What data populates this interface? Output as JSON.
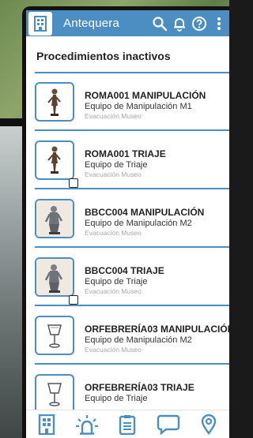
{
  "header": {
    "title": "Antequera"
  },
  "section": {
    "title": "Procedimientos inactivos"
  },
  "procedures": [
    {
      "title": "ROMA001 MANIPULACIÓN",
      "team": "Equipo de Manipulación M1",
      "type": "Evacuación Museo",
      "checkbox": false
    },
    {
      "title": "ROMA001 TRIAJE",
      "team": "Equipo de Triaje",
      "type": "Evacuación Museo",
      "checkbox": true
    },
    {
      "title": "BBCC004 MANIPULACIÓN",
      "team": "Equipo de Manipulación M2",
      "type": "Evacuación Museo",
      "checkbox": false
    },
    {
      "title": "BBCC004 TRIAJE",
      "team": "Equipo de Triaje",
      "type": "Evacuación Museo",
      "checkbox": true
    },
    {
      "title": "ORFEBRERÍA03 MANIPULACIÓN",
      "team": "Equipo de Manipulación M2",
      "type": "Evacuación Museo",
      "checkbox": false
    },
    {
      "title": "ORFEBRERÍA03 TRIAJE",
      "team": "Equipo de Triaje",
      "type": "",
      "checkbox": false
    }
  ],
  "icons": {
    "header_logo": "building-icon",
    "header_actions": [
      "search-icon",
      "bell-icon",
      "help-icon",
      "more-vertical-icon"
    ],
    "bottom_nav": [
      "building-icon",
      "alarm-light-icon",
      "clipboard-icon",
      "chat-icon",
      "location-icon"
    ]
  },
  "colors": {
    "accent": "#4c8ec2",
    "title_text": "#222222",
    "meta_text": "#a7a7a7"
  }
}
